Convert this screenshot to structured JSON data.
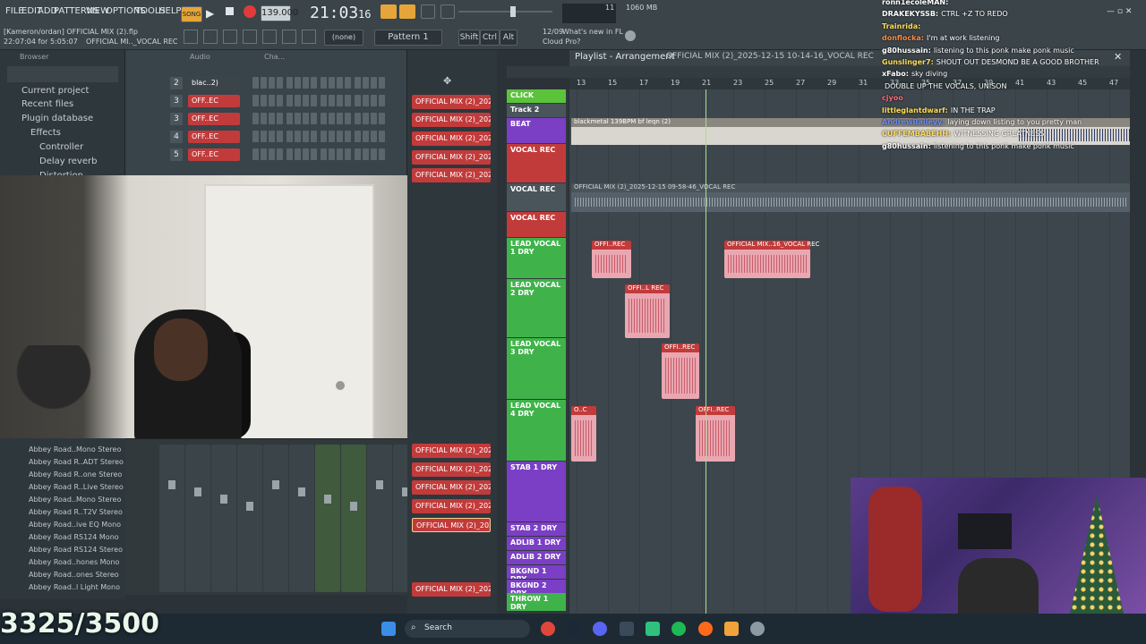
{
  "menu": [
    "FILE",
    "EDIT",
    "ADD",
    "PATTERNS",
    "VIEW",
    "OPTIONS",
    "TOOLS",
    "HELP"
  ],
  "project": {
    "line1": "[Kameron/ordan] OFFICIAL MIX (2).flp",
    "line2": "22:07:04 for 5:05:07",
    "line3": "OFFICIAL MI.._VOCAL REC"
  },
  "transport": {
    "mode": "SONG",
    "tempo": "139.000",
    "time": "21:03",
    "time_sub": "16",
    "memory": "1060 MB",
    "cpu": "11",
    "pattern": "Pattern 1",
    "snap": "(none)",
    "keys": [
      "Shift",
      "Ctrl",
      "Alt"
    ],
    "news_date": "12/09",
    "news_text": "What's new in FL",
    "news_sub": "Cloud Pro?"
  },
  "browser": {
    "title": "Browser",
    "items": [
      "Current project",
      "Recent files",
      "Plugin database",
      "Effects",
      "Controller",
      "Delay reverb",
      "Distortion"
    ]
  },
  "channel_rack": {
    "title": "Audio",
    "title2": "Cha...",
    "rows": [
      {
        "num": "2",
        "name": "blac..2)"
      },
      {
        "num": "3",
        "name": "OFF..EC"
      },
      {
        "num": "3",
        "name": "OFF..EC"
      },
      {
        "num": "4",
        "name": "OFF..EC"
      },
      {
        "num": "5",
        "name": "OFF..EC"
      }
    ]
  },
  "plugins": [
    "Abbey Road..Mono Stereo",
    "Abbey Road R..ADT Stereo",
    "Abbey Road R..one Stereo",
    "Abbey Road R..Live Stereo",
    "Abbey Road..Mono Stereo",
    "Abbey Road R..T2V Stereo",
    "Abbey Road..ive EQ Mono",
    "Abbey Road RS124 Mono",
    "Abbey Road RS124 Stereo",
    "Abbey Road..hones Mono",
    "Abbey Road..ones Stereo",
    "Abbey Road..l Light Mono"
  ],
  "playlist": {
    "title": "Playlist - Arrangement",
    "file": "OFFICIAL MIX (2)_2025-12-15 10-14-16_VOCAL REC",
    "ruler": [
      "13",
      "15",
      "17",
      "19",
      "21",
      "23",
      "25",
      "27",
      "29",
      "31",
      "33",
      "35",
      "37",
      "39",
      "41",
      "43",
      "45",
      "47"
    ],
    "patterns": [
      "OFFICIAL MIX (2)_2025-1...",
      "OFFICIAL MIX (2)_2025-1...",
      "OFFICIAL MIX (2)_2025-1...",
      "OFFICIAL MIX (2)_2025-1...",
      "OFFICIAL MIX (2)_2025-1...",
      "OFFICIAL MIX (2)_2025-1...",
      "OFFICIAL MIX (2)_2025-1...",
      "OFFICIAL MIX (2)_2025-1...",
      "OFFICIAL MIX (2)_2025-1...",
      "OFFICIAL MIX (2)_2025-1...",
      "OFFICIAL MIX (2)_2025-1..."
    ],
    "tracks": [
      {
        "name": "CLICK",
        "color": "#5bc23c"
      },
      {
        "name": "Track 2",
        "color": "#4a555b"
      },
      {
        "name": "BEAT",
        "color": "#7b3fc6"
      },
      {
        "name": "VOCAL REC",
        "color": "#c23b3b"
      },
      {
        "name": "VOCAL REC",
        "color": "#4a555b"
      },
      {
        "name": "VOCAL REC",
        "color": "#c23b3b"
      },
      {
        "name": "LEAD VOCAL 1 DRY",
        "color": "#3fb34a"
      },
      {
        "name": "LEAD VOCAL 2 DRY",
        "color": "#3fb34a"
      },
      {
        "name": "LEAD VOCAL 3 DRY",
        "color": "#3fb34a"
      },
      {
        "name": "LEAD VOCAL 4 DRY",
        "color": "#3fb34a"
      },
      {
        "name": "STAB 1 DRY",
        "color": "#7b3fc6"
      },
      {
        "name": "STAB 2 DRY",
        "color": "#7b3fc6"
      },
      {
        "name": "ADLIB 1 DRY",
        "color": "#7b3fc6"
      },
      {
        "name": "ADLIB 2 DRY",
        "color": "#7b3fc6"
      },
      {
        "name": "BKGND 1 DRY",
        "color": "#7b3fc6"
      },
      {
        "name": "BKGND 2 DRY",
        "color": "#7b3fc6"
      },
      {
        "name": "THROW 1 DRY",
        "color": "#3fb34a"
      }
    ],
    "beat_clip": "blackmetal 139BPM bf leqn (2)",
    "vocal_clip": "OFFICIAL MIX (2)_2025-12-15 09-58-46_VOCAL REC",
    "clips": [
      {
        "label": "OFFI..REC"
      },
      {
        "label": "OFFICIAL MIX..16_VOCAL REC"
      },
      {
        "label": "OFFI..L REC"
      },
      {
        "label": "OFFI..REC"
      },
      {
        "label": "O..C"
      },
      {
        "label": "OFFI..REC"
      }
    ]
  },
  "chat": [
    {
      "user": "ronn1ecoleMAN:",
      "msg": "",
      "color": "#ffffff"
    },
    {
      "user": "DRAKEKYSSB:",
      "msg": "CTRL +Z TO REDO",
      "color": "#ffffff"
    },
    {
      "user": "Trainrida:",
      "msg": "",
      "color": "#ffdd55"
    },
    {
      "user": "donflocka:",
      "msg": "I'm at work listening",
      "color": "#ff8844"
    },
    {
      "user": "g80hussain:",
      "msg": "listening to this ponk make ponk music",
      "color": "#ffffff"
    },
    {
      "user": "Gunslinger7:",
      "msg": "SHOUT OUT DESMOND BE A GOOD BROTHER",
      "color": "#ffdd55"
    },
    {
      "user": "xFabo:",
      "msg": "sky diving",
      "color": "#ffffff"
    },
    {
      "user": "",
      "msg": "DOUBLE UP THE VOCALS, UNISON",
      "color": "#ffffff"
    },
    {
      "user": "cjyoo",
      "msg": "",
      "color": "#ff6677"
    },
    {
      "user": "littleglantdwarf:",
      "msg": "IN THE TRAP",
      "color": "#ffdd55"
    },
    {
      "user": "AndrewBaileyy:",
      "msg": "laying down listing to you pretty man",
      "color": "#6b8cff"
    },
    {
      "user": "CUFFEMBABEHH:",
      "msg": "WITNESSING GREATNESS",
      "color": "#ffdd55"
    },
    {
      "user": "g80hussain:",
      "msg": "listening to this ponk make ponk music",
      "color": "#ffffff"
    }
  ],
  "overlay_counter": "3325/3500",
  "taskbar": {
    "search_placeholder": "Search"
  }
}
